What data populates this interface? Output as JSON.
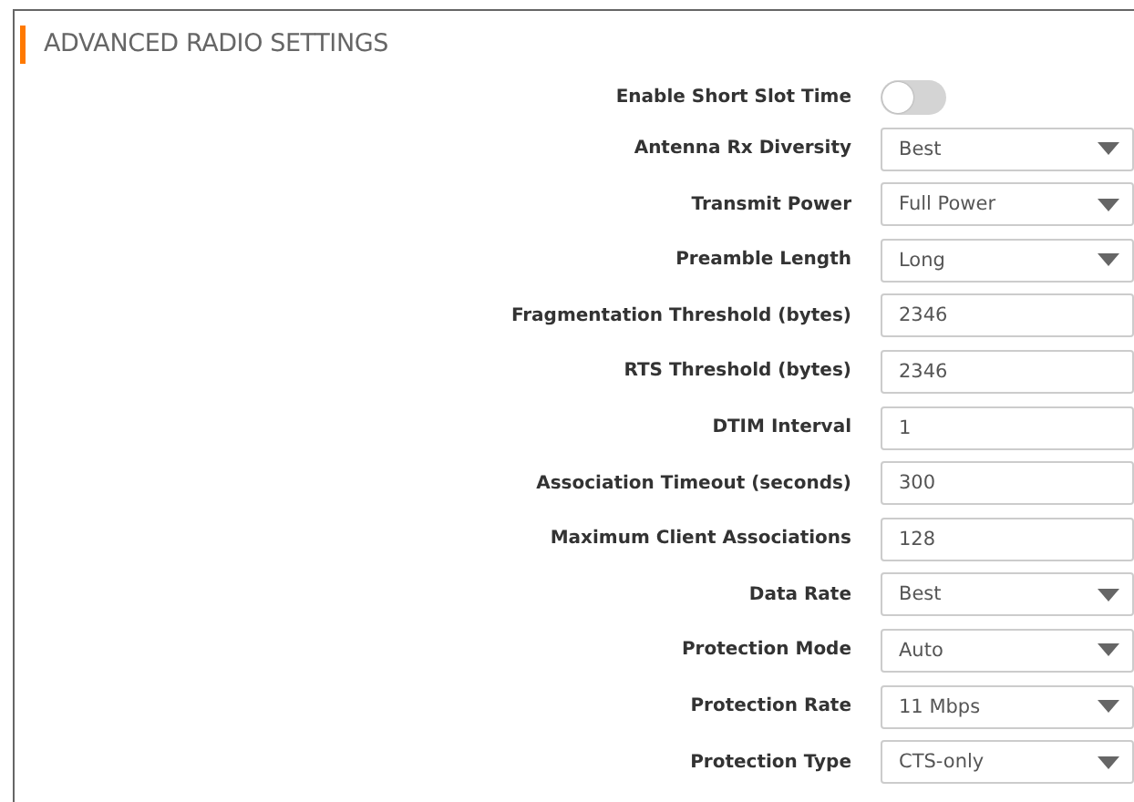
{
  "section": {
    "title": "ADVANCED RADIO SETTINGS"
  },
  "settings": [
    {
      "label": "Enable Short Slot Time",
      "kind": "toggle",
      "on": false
    },
    {
      "label": "Antenna Rx Diversity",
      "kind": "select",
      "value": "Best"
    },
    {
      "label": "Transmit Power",
      "kind": "select",
      "value": "Full Power"
    },
    {
      "label": "Preamble Length",
      "kind": "select",
      "value": "Long"
    },
    {
      "label": "Fragmentation Threshold (bytes)",
      "kind": "text",
      "value": "2346"
    },
    {
      "label": "RTS Threshold (bytes)",
      "kind": "text",
      "value": "2346"
    },
    {
      "label": "DTIM Interval",
      "kind": "text",
      "value": "1"
    },
    {
      "label": "Association Timeout (seconds)",
      "kind": "text",
      "value": "300"
    },
    {
      "label": "Maximum Client Associations",
      "kind": "text",
      "value": "128"
    },
    {
      "label": "Data Rate",
      "kind": "select",
      "value": "Best"
    },
    {
      "label": "Protection Mode",
      "kind": "select",
      "value": "Auto"
    },
    {
      "label": "Protection Rate",
      "kind": "select",
      "value": "11 Mbps"
    },
    {
      "label": "Protection Type",
      "kind": "select",
      "value": "CTS-only"
    }
  ]
}
